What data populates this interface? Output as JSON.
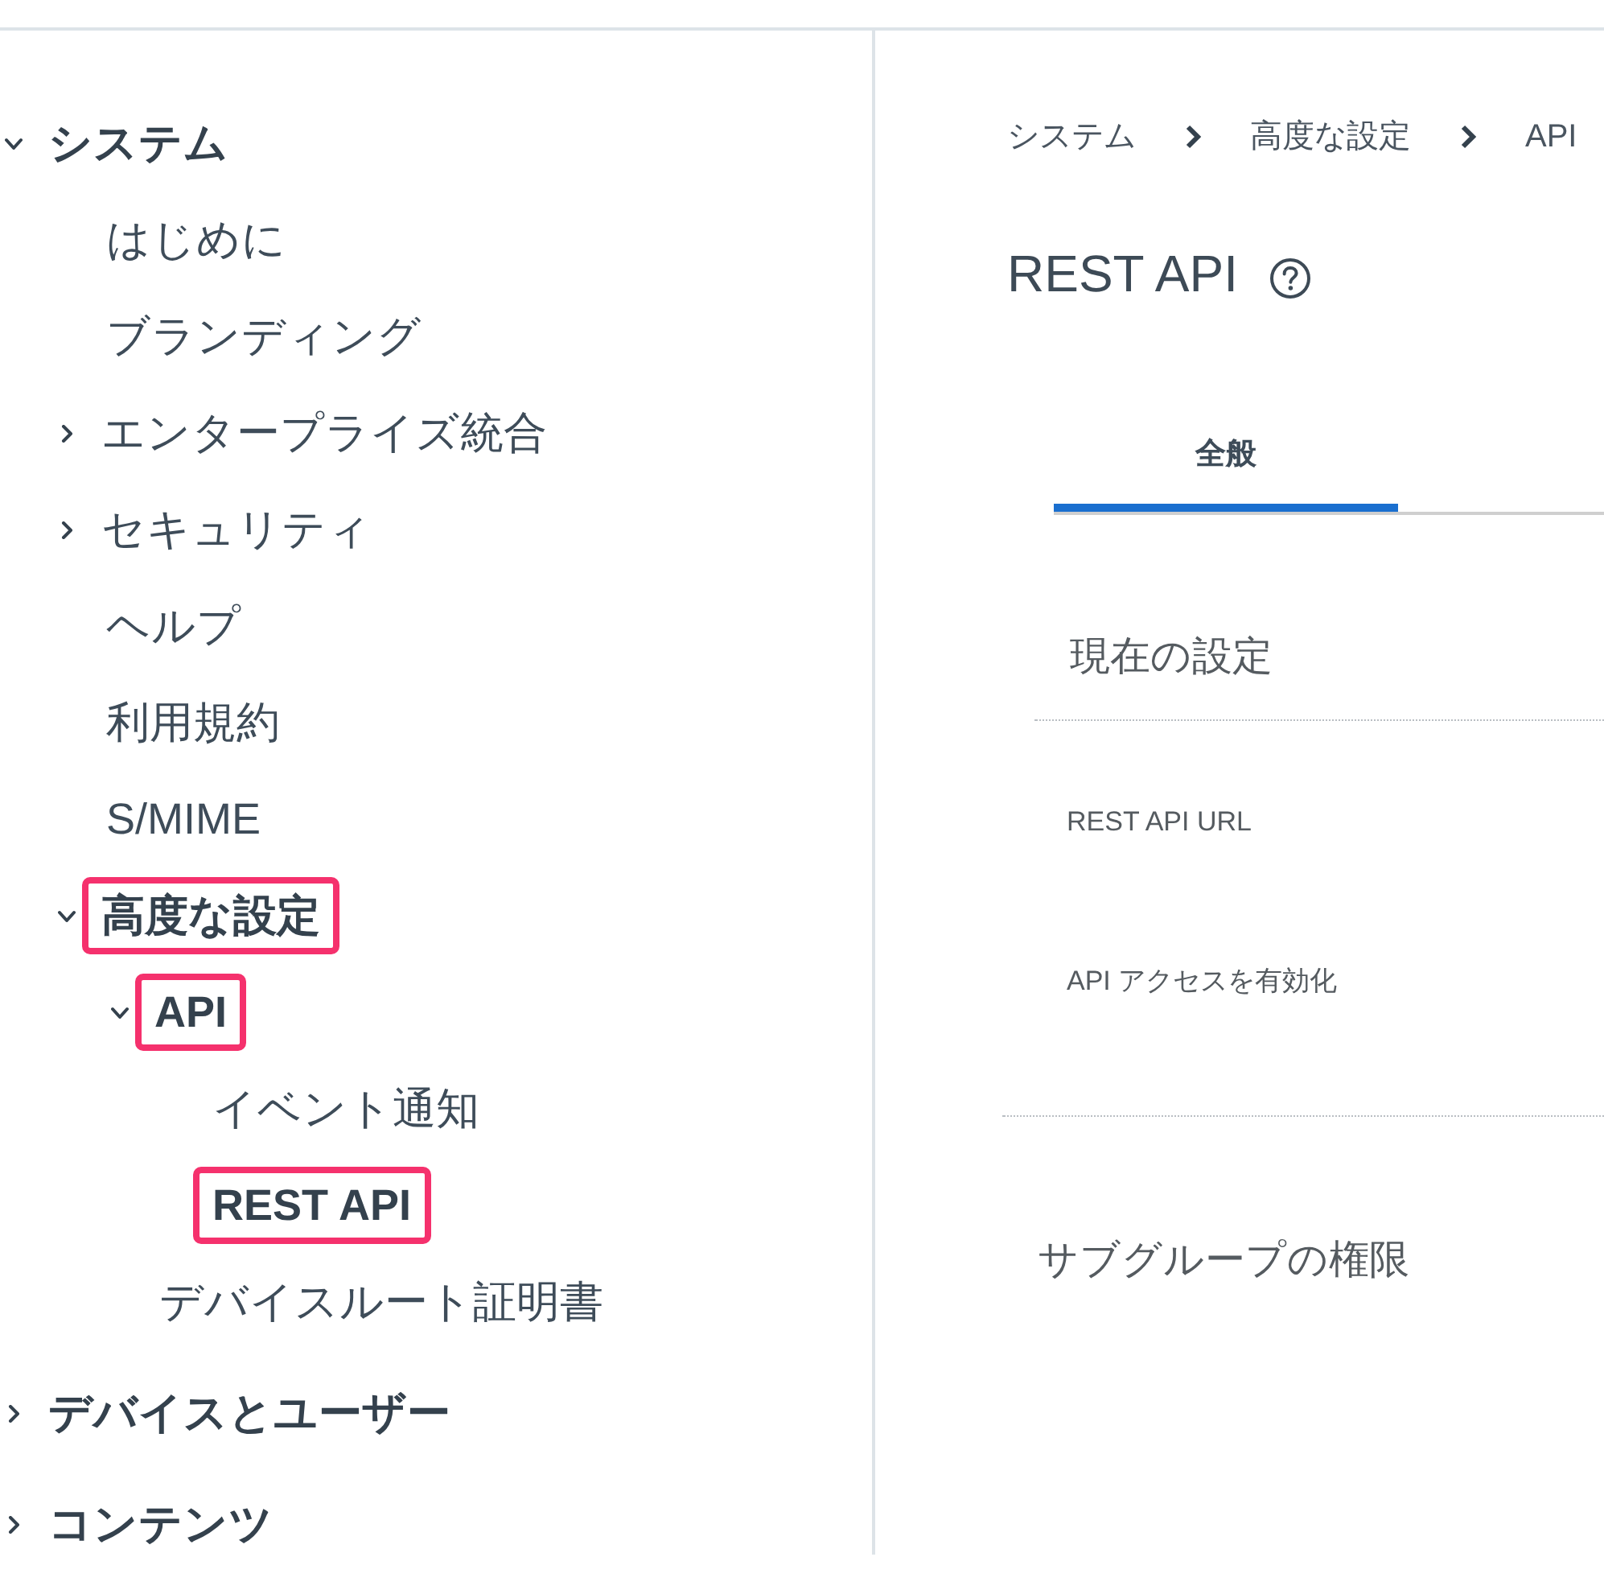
{
  "sidebar": {
    "items": [
      {
        "label": "システム",
        "expanded": true,
        "highlighted": false,
        "children": [
          {
            "label": "はじめに",
            "highlighted": false
          },
          {
            "label": "ブランディング",
            "highlighted": false
          },
          {
            "label": "エンタープライズ統合",
            "expanded": false,
            "highlighted": false
          },
          {
            "label": "セキュリティ",
            "expanded": false,
            "highlighted": false
          },
          {
            "label": "ヘルプ",
            "highlighted": false
          },
          {
            "label": "利用規約",
            "highlighted": false
          },
          {
            "label": "S/MIME",
            "highlighted": false
          },
          {
            "label": "高度な設定",
            "expanded": true,
            "highlighted": true,
            "children": [
              {
                "label": "API",
                "expanded": true,
                "highlighted": true,
                "children": [
                  {
                    "label": "イベント通知",
                    "highlighted": false
                  },
                  {
                    "label": "REST API",
                    "highlighted": true
                  }
                ]
              },
              {
                "label": "デバイスルート証明書",
                "highlighted": false
              }
            ]
          }
        ]
      },
      {
        "label": "デバイスとユーザー",
        "expanded": false,
        "highlighted": false
      },
      {
        "label": "コンテンツ",
        "expanded": false,
        "highlighted": false
      }
    ]
  },
  "breadcrumb": [
    {
      "label": "システム"
    },
    {
      "label": "高度な設定"
    },
    {
      "label": "API"
    }
  ],
  "page": {
    "title": "REST API"
  },
  "tabs": [
    {
      "label": "全般",
      "selected": true
    }
  ],
  "sections": [
    {
      "title": "現在の設定",
      "fields": [
        {
          "label": "REST API URL"
        },
        {
          "label": "API アクセスを有効化"
        }
      ]
    },
    {
      "title": "サブグループの権限"
    }
  ]
}
